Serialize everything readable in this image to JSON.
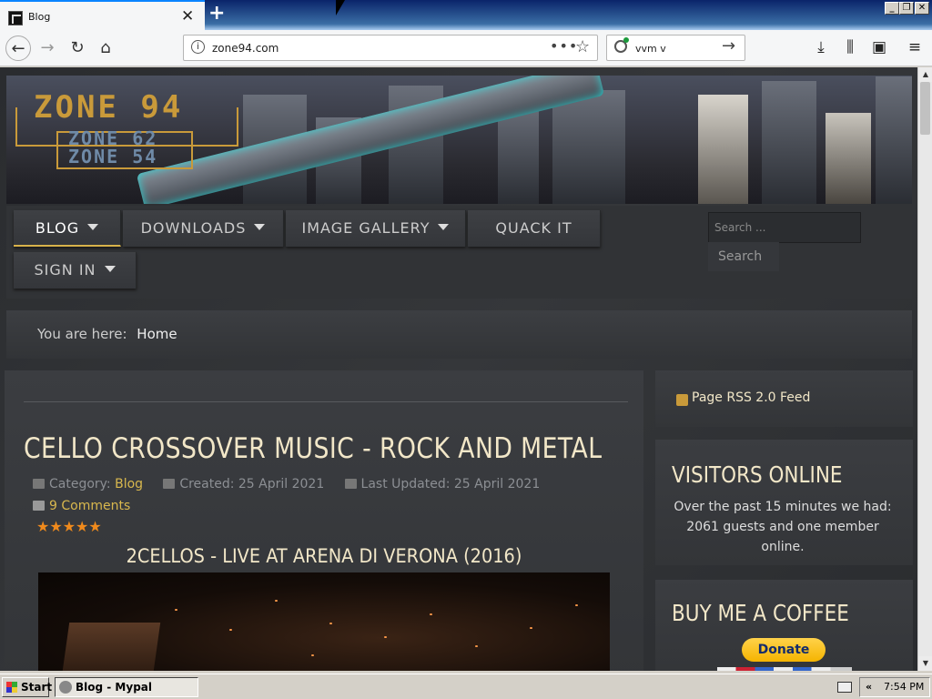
{
  "browser": {
    "tab_title": "Blog",
    "url": "zone94.com",
    "search_text": "vvm v"
  },
  "site": {
    "logo": {
      "main": "ZONE 94",
      "sub1": "ZONE 62",
      "sub2": "ZONE 54"
    },
    "menu": [
      {
        "label": "BLOG",
        "dropdown": true,
        "active": true
      },
      {
        "label": "DOWNLOADS",
        "dropdown": true
      },
      {
        "label": "IMAGE GALLERY",
        "dropdown": true
      },
      {
        "label": "QUACK IT",
        "dropdown": false
      },
      {
        "label": "SIGN IN",
        "dropdown": true
      }
    ],
    "search_placeholder": "Search ...",
    "search_button": "Search",
    "breadcrumb": {
      "prefix": "You are here:",
      "current": "Home"
    }
  },
  "article": {
    "title": "CELLO CROSSOVER MUSIC - ROCK AND METAL",
    "category_label": "Category:",
    "category": "Blog",
    "created": "Created: 25 April 2021",
    "updated": "Last Updated: 25 April 2021",
    "comments": "9 Comments",
    "stars": "★★★★★",
    "subtitle": "2CELLOS - LIVE AT ARENA DI VERONA (2016)"
  },
  "sidebar": {
    "rss": "Page RSS 2.0 Feed",
    "visitors_title": "VISITORS ONLINE",
    "visitors_text": "Over the past 15 minutes we had: 2061 guests and one member online.",
    "coffee_title": "BUY ME A COFFEE",
    "donate": "Donate"
  },
  "taskbar": {
    "start": "Start",
    "window": "Blog - Mypal",
    "time": "7:54 PM",
    "chevron": "«"
  },
  "colors": {
    "accent": "#d9b84e",
    "title": "#f2e7c8",
    "star": "#f08a1c"
  },
  "icons": [
    "back-icon",
    "forward-icon",
    "reload-icon",
    "home-icon",
    "info-icon",
    "more-icon",
    "bookmark-star-icon",
    "search-icon",
    "go-arrow-icon",
    "download-icon",
    "library-icon",
    "sidebar-icon",
    "hamburger-menu-icon",
    "rss-icon",
    "folder-icon",
    "calendar-icon",
    "comment-icon"
  ]
}
